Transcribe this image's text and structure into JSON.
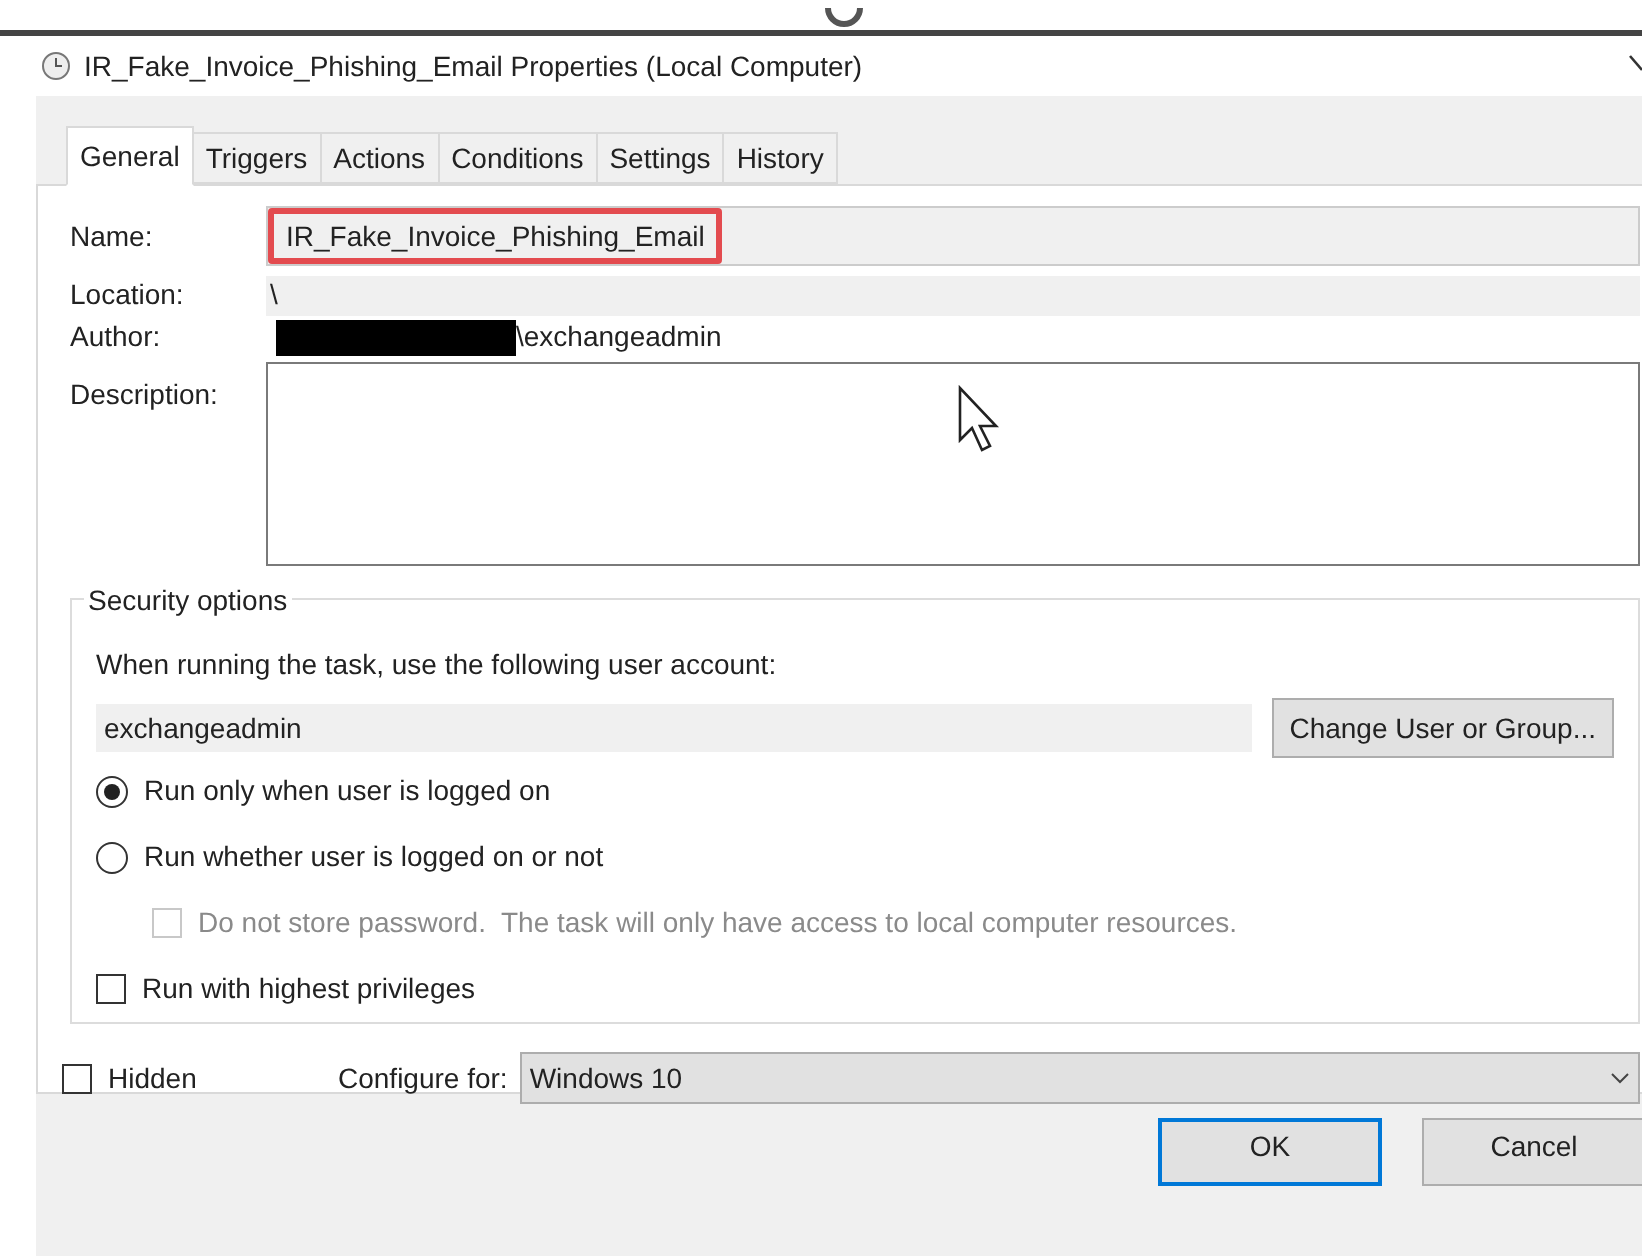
{
  "window": {
    "title": "IR_Fake_Invoice_Phishing_Email Properties (Local Computer)"
  },
  "tabs": [
    {
      "label": "General",
      "selected": true
    },
    {
      "label": "Triggers",
      "selected": false
    },
    {
      "label": "Actions",
      "selected": false
    },
    {
      "label": "Conditions",
      "selected": false
    },
    {
      "label": "Settings",
      "selected": false
    },
    {
      "label": "History",
      "selected": false
    }
  ],
  "general": {
    "name": {
      "label": "Name:",
      "value": "IR_Fake_Invoice_Phishing_Email",
      "highlighted": true
    },
    "location": {
      "label": "Location:",
      "value": "\\"
    },
    "author": {
      "label": "Author:",
      "value": "\\exchangeadmin",
      "redacted": true
    },
    "description": {
      "label": "Description:"
    }
  },
  "security_options": {
    "title": "Security options",
    "account_label": "When running the task, use the following user account:",
    "account": "exchangeadmin",
    "change_button": "Change User or Group...",
    "options": [
      {
        "kind": "radio",
        "label": "Run only when user is logged on",
        "selected": true,
        "disabled": false,
        "indented": false
      },
      {
        "kind": "radio",
        "label": "Run whether user is logged on or not",
        "selected": false,
        "disabled": false,
        "indented": false
      },
      {
        "kind": "checkbox",
        "label": "Do not store password.  The task will only have access to local computer resources.",
        "checked": false,
        "disabled": true,
        "indented": true
      },
      {
        "kind": "checkbox",
        "label": "Run with highest privileges",
        "checked": false,
        "disabled": false,
        "indented": false
      }
    ]
  },
  "hidden": {
    "label": "Hidden",
    "checked": false
  },
  "configure": {
    "label": "Configure for:",
    "value": "Windows 10"
  },
  "buttons": [
    {
      "label": "OK",
      "default": true
    },
    {
      "label": "Cancel",
      "default": false
    }
  ]
}
